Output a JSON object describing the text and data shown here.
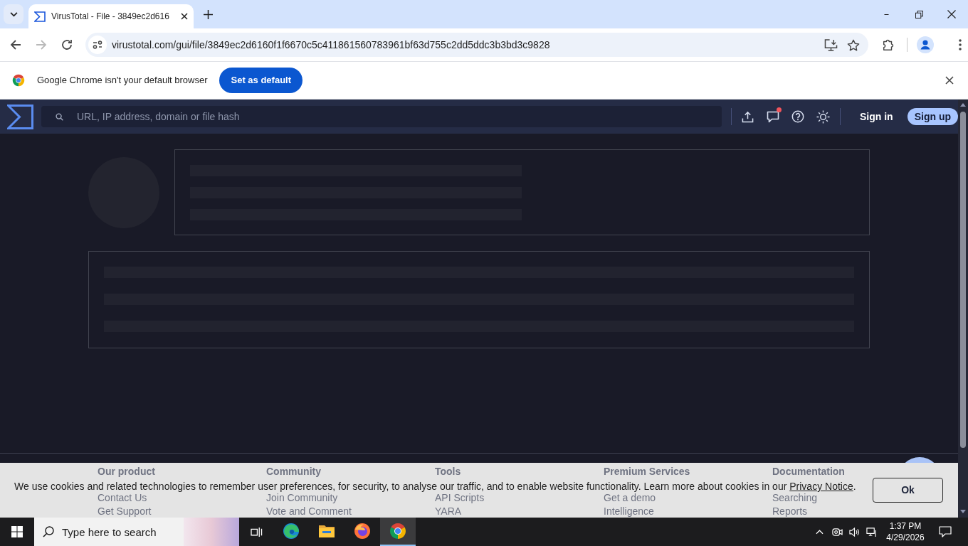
{
  "browser": {
    "tabs": [
      {
        "title": "VirusTotal - File - 3849ec2d616",
        "selected": true
      }
    ],
    "toolbar": {
      "forward_disabled": true,
      "address": "virustotal.com/gui/file/3849ec2d6160f1f6670c5c411861560783961bf63d755c2dd5ddc3b3bd3c9828"
    },
    "infobar": {
      "message": "Google Chrome isn't your default browser",
      "button": "Set as default"
    }
  },
  "site": {
    "header": {
      "search": {
        "placeholder": "URL, IP address, domain or file hash"
      },
      "notifications_unread": true,
      "sign_in": "Sign in",
      "sign_up": "Sign up"
    },
    "footer": {
      "columns": [
        {
          "heading": "Our product",
          "links": [
            "Contact Us",
            "Get Support"
          ]
        },
        {
          "heading": "Community",
          "links": [
            "Join Community",
            "Vote and Comment"
          ]
        },
        {
          "heading": "Tools",
          "links": [
            "API Scripts",
            "YARA"
          ]
        },
        {
          "heading": "Premium Services",
          "links": [
            "Get a demo",
            "Intelligence"
          ]
        },
        {
          "heading": "Documentation",
          "links": [
            "Searching",
            "Reports"
          ]
        }
      ]
    },
    "cookie_banner": {
      "text": "We use cookies and related technologies to remember user preferences, for security, to analyse our traffic, and to enable website functionality. Learn more about cookies in our",
      "link": "Privacy Notice",
      "end": ".",
      "button": "Ok"
    }
  },
  "taskbar": {
    "search": {
      "placeholder": "Type here to search"
    },
    "apps": [
      {
        "kind": "edge",
        "selected": false
      },
      {
        "kind": "explorer",
        "selected": false
      },
      {
        "kind": "firefox",
        "selected": false
      },
      {
        "kind": "chrome",
        "selected": true
      }
    ],
    "clock": {
      "time": "1:37 PM",
      "date": "4/29/2026"
    }
  }
}
